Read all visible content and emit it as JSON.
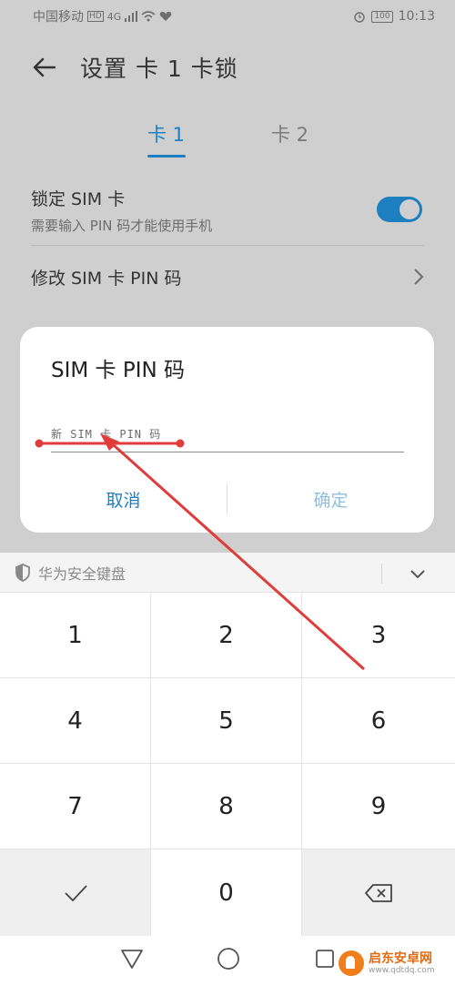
{
  "status": {
    "carrier": "中国移动",
    "hd": "HD",
    "network": "4G",
    "battery": "100",
    "time": "10:13"
  },
  "header": {
    "title": "设置 卡 1 卡锁"
  },
  "tabs": [
    {
      "label": "卡 1",
      "active": true
    },
    {
      "label": "卡 2",
      "active": false
    }
  ],
  "settings": {
    "lock_sim": {
      "title": "锁定 SIM 卡",
      "subtitle": "需要输入 PIN 码才能使用手机",
      "enabled": true
    },
    "change_pin": {
      "label": "修改 SIM 卡 PIN 码"
    }
  },
  "dialog": {
    "title": "SIM 卡 PIN 码",
    "input_placeholder": "新 SIM 卡 PIN 码",
    "input_value": "",
    "cancel_label": "取消",
    "confirm_label": "确定"
  },
  "keyboard": {
    "name": "华为安全键盘",
    "keys": [
      "1",
      "2",
      "3",
      "4",
      "5",
      "6",
      "7",
      "8",
      "9",
      "✓",
      "0",
      "⌫"
    ]
  },
  "watermark": {
    "name": "启东安卓网",
    "url": "www.qdtdq.com"
  },
  "colors": {
    "accent": "#1d7fc0",
    "annotation": "#e03c3c",
    "watermark": "#f07e1a"
  },
  "icons": [
    "back-arrow-icon",
    "chevron-right-icon",
    "shield-icon",
    "chevron-down-icon",
    "nav-back-icon",
    "nav-home-icon",
    "nav-recent-icon"
  ]
}
